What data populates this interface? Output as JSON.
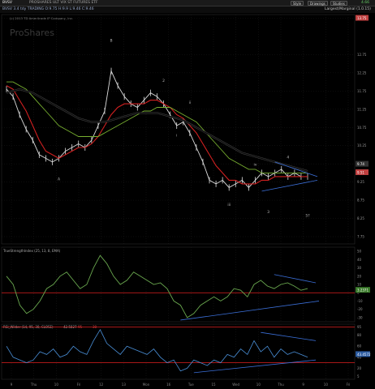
{
  "toolbar": {
    "symbol": "BVSV",
    "title": "PROSHARES ULT VIX ST FUTURES ETF",
    "buttons": [
      "Style",
      "Drawings",
      "Studies"
    ],
    "price_tag": "4.66"
  },
  "subbar": {
    "quote": "BVSV 3.4 tdy TRADING O:9.75 H:9.9 L:9.46 C:9.46",
    "study": "Largest/Marginal (1.0.15)"
  },
  "watermark": "ProShares",
  "copyright": "(c) 2013 TD Ameritrade IP Company, Inc.",
  "colors": {
    "background": "#000000",
    "price_bars": "#dddddd",
    "ma_red": "#d02020",
    "ma_green": "#78b030",
    "ma_black": "#1a1a1a",
    "trendline_blue": "#3b6fd8",
    "level_red": "#e02020",
    "tsi_line": "#6aa84f",
    "rsi_line": "#4a90d9",
    "price_label": "#e05050"
  },
  "chart_data": [
    {
      "type": "line",
      "panel": "price",
      "title": "",
      "price_scale_labels": [
        "13.75",
        "12.75",
        "12.25",
        "11.75",
        "11.25",
        "10.75",
        "10.25",
        "9.75",
        "9.25",
        "8.75",
        "8.25",
        "7.75"
      ],
      "last_price_labels": [
        "13.75",
        "9.74",
        "9.51"
      ],
      "ylim": [
        7.55,
        13.85
      ],
      "series": [
        {
          "values": [
            11.8,
            11.6,
            11.1,
            10.7,
            10.4,
            10.0,
            9.9,
            9.8,
            9.9,
            10.1,
            10.2,
            10.3,
            10.2,
            10.4,
            10.8,
            11.2,
            12.3,
            11.9,
            11.6,
            11.4,
            11.3,
            11.5,
            11.7,
            11.6,
            11.4,
            11.1,
            10.8,
            10.9,
            10.6,
            10.2,
            9.8,
            9.3,
            9.2,
            9.3,
            9.1,
            9.2,
            9.3,
            9.1,
            9.3,
            9.5,
            9.4,
            9.5,
            9.6,
            9.4,
            9.5,
            9.4,
            9.4
          ]
        },
        {
          "values": [
            11.9,
            11.8,
            11.5,
            11.2,
            10.8,
            10.4,
            10.1,
            10.0,
            9.9,
            10.0,
            10.1,
            10.2,
            10.2,
            10.3,
            10.5,
            10.8,
            11.1,
            11.3,
            11.4,
            11.4,
            11.4,
            11.4,
            11.5,
            11.5,
            11.4,
            11.3,
            11.1,
            11.0,
            10.8,
            10.6,
            10.3,
            10.0,
            9.7,
            9.5,
            9.3,
            9.3,
            9.2,
            9.2,
            9.2,
            9.3,
            9.3,
            9.4,
            9.4,
            9.4,
            9.4,
            9.4,
            9.4
          ]
        },
        {
          "values": [
            12.0,
            12.0,
            11.9,
            11.8,
            11.6,
            11.4,
            11.2,
            11.0,
            10.8,
            10.7,
            10.6,
            10.5,
            10.5,
            10.5,
            10.5,
            10.6,
            10.7,
            10.8,
            10.9,
            11.0,
            11.1,
            11.2,
            11.2,
            11.3,
            11.3,
            11.3,
            11.2,
            11.1,
            11.0,
            10.9,
            10.7,
            10.5,
            10.3,
            10.1,
            9.9,
            9.8,
            9.7,
            9.6,
            9.6,
            9.5,
            9.5,
            9.5,
            9.5,
            9.5,
            9.5,
            9.5,
            9.5
          ]
        },
        {
          "values": [
            11.7,
            11.75,
            11.8,
            11.75,
            11.7,
            11.6,
            11.5,
            11.4,
            11.3,
            11.2,
            11.1,
            11.0,
            10.95,
            10.9,
            10.9,
            10.9,
            10.95,
            11.0,
            11.05,
            11.1,
            11.15,
            11.15,
            11.15,
            11.15,
            11.1,
            11.05,
            11.0,
            10.95,
            10.85,
            10.75,
            10.65,
            10.55,
            10.45,
            10.35,
            10.25,
            10.15,
            10.05,
            10.0,
            9.95,
            9.9,
            9.85,
            9.8,
            9.75,
            9.7,
            9.65,
            9.6,
            9.55
          ]
        }
      ],
      "wave_labels": [
        "A",
        "B",
        "2",
        "ii",
        "i",
        "iii",
        "iv",
        "3",
        "4",
        "5?"
      ],
      "annotations": []
    },
    {
      "type": "line",
      "panel": "tsi",
      "title": "TrueStrengthIndex (25, 13, 8, EMA)",
      "last_value_label": "3.2371",
      "scale_labels": [
        "50",
        "40",
        "30",
        "20",
        "10",
        "0",
        "-10",
        "-20",
        "-30"
      ],
      "reference_line": 0,
      "ylim": [
        -35,
        55
      ],
      "values": [
        20,
        10,
        -15,
        -25,
        -20,
        -10,
        5,
        10,
        20,
        25,
        15,
        5,
        10,
        30,
        45,
        35,
        20,
        10,
        15,
        25,
        20,
        15,
        10,
        12,
        5,
        -10,
        -15,
        -30,
        -25,
        -15,
        -10,
        -5,
        -10,
        -5,
        5,
        3,
        -5,
        10,
        15,
        8,
        5,
        10,
        12,
        8,
        3,
        5
      ]
    },
    {
      "type": "line",
      "panel": "rsi",
      "title": "RSI_Wilder (14, 95, 30, CLOSE)",
      "header_values": [
        "42.5827",
        "95",
        "30"
      ],
      "last_value_label": "43.4572",
      "scale_labels": [
        "95",
        "80",
        "60",
        "40",
        "20",
        "5"
      ],
      "ylim": [
        0,
        100
      ],
      "upper_line": 95,
      "lower_line": 30,
      "values": [
        60,
        40,
        35,
        30,
        35,
        50,
        45,
        55,
        40,
        45,
        60,
        50,
        45,
        70,
        90,
        65,
        55,
        45,
        60,
        55,
        50,
        45,
        55,
        40,
        30,
        35,
        15,
        20,
        35,
        30,
        25,
        35,
        30,
        45,
        40,
        55,
        45,
        70,
        50,
        60,
        40,
        55,
        45,
        50,
        45,
        40
      ]
    }
  ],
  "time_axis": {
    "tick_labels": [
      "9",
      "Thu",
      "10",
      "Fri",
      "12",
      "13",
      "Mon",
      "16",
      "Tue",
      "15",
      "Wed",
      "10",
      "Thu",
      "9",
      "10",
      "Fri"
    ]
  }
}
